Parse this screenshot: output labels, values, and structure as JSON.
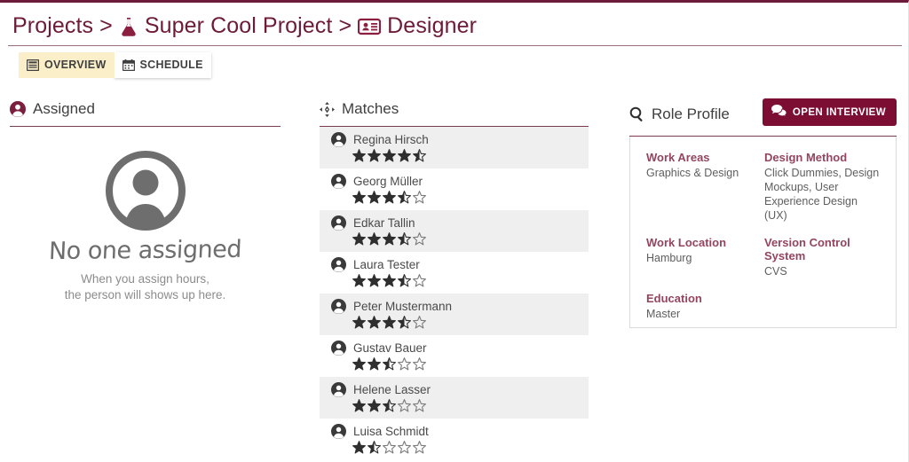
{
  "theme": {
    "accent": "#6d1b38",
    "button_bg": "#7c0d33",
    "active_tab_bg": "#faefc8",
    "row_alt_bg": "#efefef",
    "label_color": "#93455f"
  },
  "breadcrumb": {
    "items": [
      {
        "label": "Projects",
        "icon": ""
      },
      {
        "label": "Super Cool Project",
        "icon": "flask-icon"
      },
      {
        "label": "Designer",
        "icon": "id-card-icon"
      }
    ],
    "separator": ">"
  },
  "tabs": [
    {
      "label": "OVERVIEW",
      "icon": "list-icon",
      "active": true
    },
    {
      "label": "SCHEDULE",
      "icon": "calendar-icon",
      "active": false
    }
  ],
  "assigned": {
    "title": "Assigned",
    "icon": "user-circle-icon",
    "empty": {
      "icon": "large-avatar-icon",
      "title": "No one assigned",
      "line1": "When you assign hours,",
      "line2": "the person will shows up here."
    }
  },
  "matches": {
    "title": "Matches",
    "icon": "arrows-compress-icon",
    "items": [
      {
        "name": "Regina Hirsch",
        "rating": 4.5
      },
      {
        "name": "Georg Müller",
        "rating": 3.5
      },
      {
        "name": "Edkar Tallin",
        "rating": 3.5
      },
      {
        "name": "Laura Tester",
        "rating": 3.5
      },
      {
        "name": "Peter Mustermann",
        "rating": 3.5
      },
      {
        "name": "Gustav Bauer",
        "rating": 2.5
      },
      {
        "name": "Helene Lasser",
        "rating": 2.5
      },
      {
        "name": "Luisa Schmidt",
        "rating": 1.5
      }
    ]
  },
  "role_profile": {
    "title": "Role Profile",
    "icon": "search-icon",
    "open_interview": {
      "label": "OPEN INTERVIEW",
      "icon": "comments-icon"
    },
    "fields": [
      {
        "label": "Work Areas",
        "value": "Graphics & Design"
      },
      {
        "label": "Design Method",
        "value": "Click Dummies, Design Mockups, User Experience Design (UX)"
      },
      {
        "label": "Work Location",
        "value": "Hamburg"
      },
      {
        "label": "Version Control System",
        "value": "CVS"
      },
      {
        "label": "Education",
        "value": "Master"
      },
      {
        "label": "",
        "value": ""
      }
    ]
  }
}
